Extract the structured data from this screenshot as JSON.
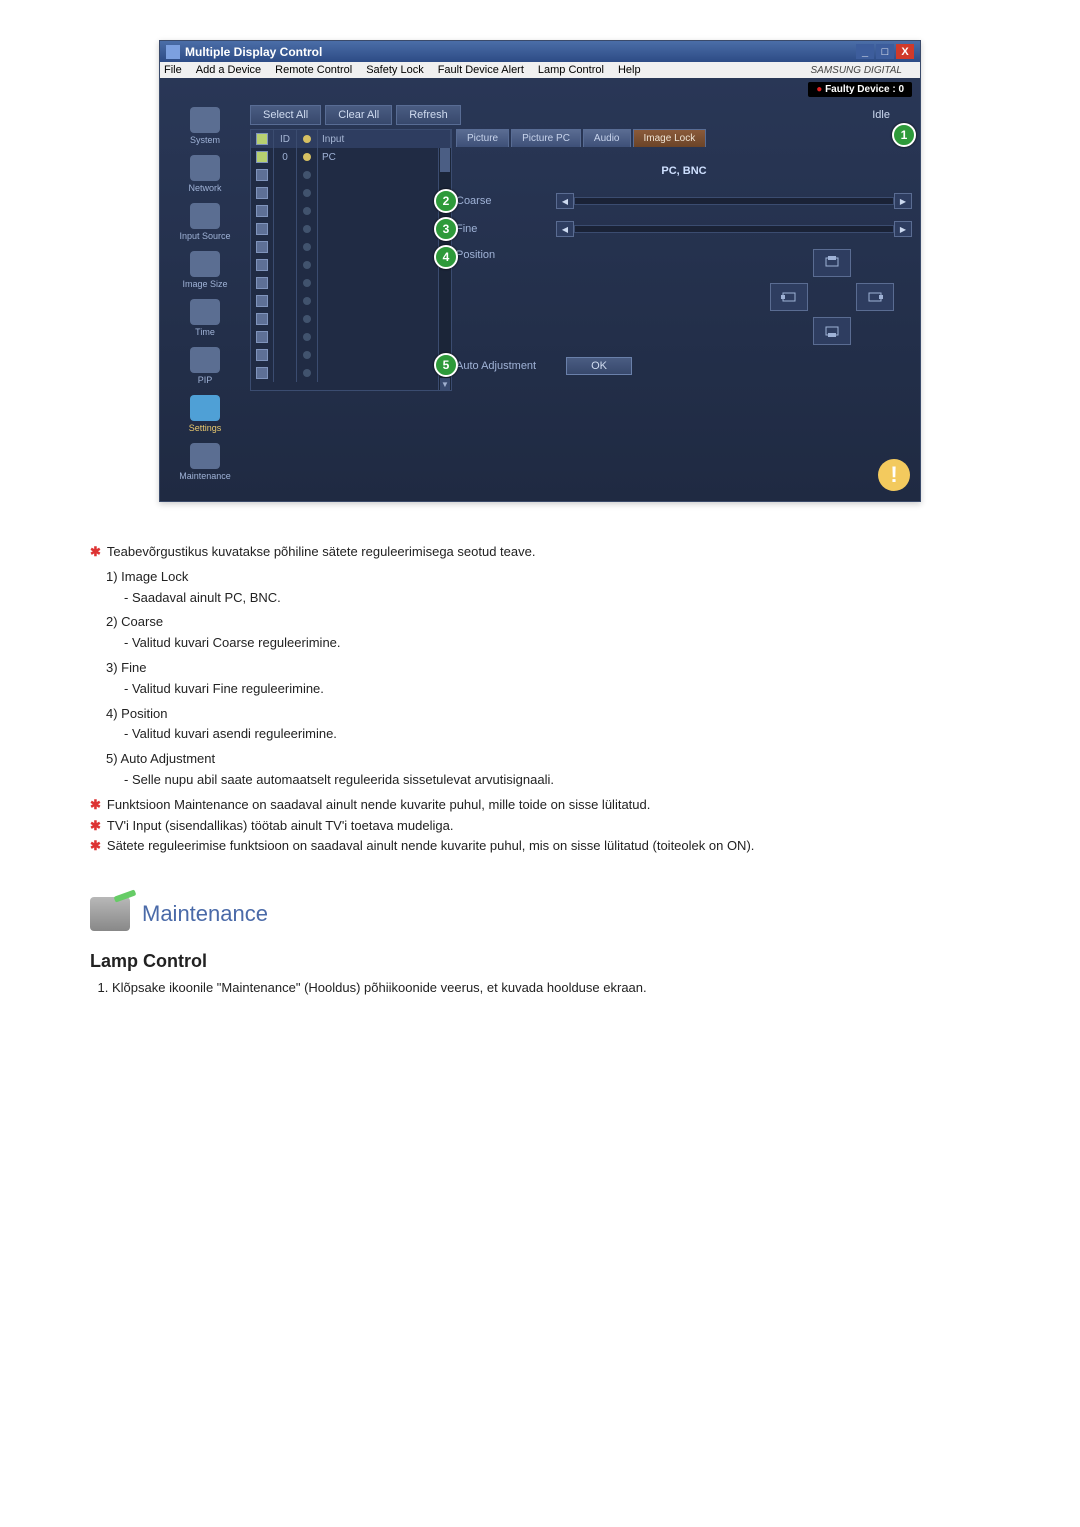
{
  "app": {
    "title": "Multiple Display Control",
    "brand": "SAMSUNG DIGITAL"
  },
  "menu": {
    "file": "File",
    "add_device": "Add a Device",
    "remote_control": "Remote Control",
    "safety_lock": "Safety Lock",
    "fault_alert": "Fault Device Alert",
    "lamp_control": "Lamp Control",
    "help": "Help"
  },
  "faulty_badge": "Faulty Device : 0",
  "sidebar": {
    "items": [
      {
        "label": "System"
      },
      {
        "label": "Network"
      },
      {
        "label": "Input Source"
      },
      {
        "label": "Image Size"
      },
      {
        "label": "Time"
      },
      {
        "label": "PIP"
      },
      {
        "label": "Settings"
      },
      {
        "label": "Maintenance"
      }
    ]
  },
  "toolbar": {
    "select_all": "Select All",
    "clear_all": "Clear All",
    "refresh": "Refresh",
    "idle": "Idle"
  },
  "grid": {
    "headers": {
      "id": "ID",
      "input": "Input"
    },
    "rows": [
      {
        "checked": true,
        "id": "0",
        "status_on": true,
        "input": "PC"
      },
      {
        "checked": false,
        "id": "",
        "status_on": false,
        "input": ""
      },
      {
        "checked": false,
        "id": "",
        "status_on": false,
        "input": ""
      },
      {
        "checked": false,
        "id": "",
        "status_on": false,
        "input": ""
      },
      {
        "checked": false,
        "id": "",
        "status_on": false,
        "input": ""
      },
      {
        "checked": false,
        "id": "",
        "status_on": false,
        "input": ""
      },
      {
        "checked": false,
        "id": "",
        "status_on": false,
        "input": ""
      },
      {
        "checked": false,
        "id": "",
        "status_on": false,
        "input": ""
      },
      {
        "checked": false,
        "id": "",
        "status_on": false,
        "input": ""
      },
      {
        "checked": false,
        "id": "",
        "status_on": false,
        "input": ""
      },
      {
        "checked": false,
        "id": "",
        "status_on": false,
        "input": ""
      },
      {
        "checked": false,
        "id": "",
        "status_on": false,
        "input": ""
      },
      {
        "checked": false,
        "id": "",
        "status_on": false,
        "input": ""
      }
    ]
  },
  "tabs": {
    "picture": "Picture",
    "picture_pc": "Picture PC",
    "audio": "Audio",
    "image_lock": "Image Lock"
  },
  "panel": {
    "pcbnc": "PC, BNC",
    "coarse": "Coarse",
    "fine": "Fine",
    "position": "Position",
    "auto_adjustment": "Auto Adjustment",
    "ok": "OK"
  },
  "callouts": {
    "c1": "1",
    "c2": "2",
    "c3": "3",
    "c4": "4",
    "c5": "5"
  },
  "doc": {
    "intro": "Teabevõrgustikus kuvatakse põhiline sätete reguleerimisega seotud teave.",
    "items": [
      {
        "num": "1)",
        "title": "Image Lock",
        "sub": "- Saadaval ainult PC, BNC."
      },
      {
        "num": "2)",
        "title": "Coarse",
        "sub": "- Valitud kuvari Coarse reguleerimine."
      },
      {
        "num": "3)",
        "title": "Fine",
        "sub": "- Valitud kuvari Fine reguleerimine."
      },
      {
        "num": "4)",
        "title": "Position",
        "sub": "- Valitud kuvari asendi reguleerimine."
      },
      {
        "num": "5)",
        "title": "Auto Adjustment",
        "sub": "- Selle nupu abil saate automaatselt reguleerida sissetulevat arvutisignaali."
      }
    ],
    "star1": "Funktsioon Maintenance on saadaval ainult nende kuvarite puhul, mille toide on sisse lülitatud.",
    "star2": "TV'i Input (sisendallikas) töötab ainult TV'i toetava mudeliga.",
    "star3": "Sätete reguleerimise funktsioon on saadaval ainult nende kuvarite puhul, mis on sisse lülitatud (toiteolek on ON)."
  },
  "maint_heading": "Maintenance",
  "section_heading": "Lamp Control",
  "section_step": "Klõpsake ikoonile \"Maintenance\" (Hooldus) põhiikoonide veerus, et kuvada hoolduse ekraan."
}
